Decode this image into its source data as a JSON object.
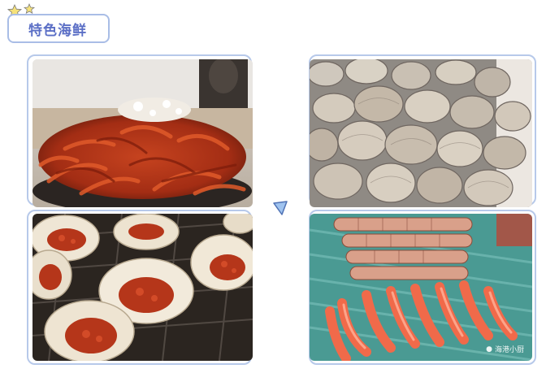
{
  "header": {
    "title": "特色海鲜"
  },
  "watermark": {
    "text": "海港小厨"
  },
  "colors": {
    "frame_border": "#b7c9ea",
    "title_text": "#5b6fc6",
    "title_border": "#a9bde6",
    "star_fill": "#f6e27a",
    "pointer": "#6d93d6"
  },
  "photos": [
    {
      "subject": "crayfish"
    },
    {
      "subject": "clams"
    },
    {
      "subject": "oysters"
    },
    {
      "subject": "shrimp"
    }
  ]
}
